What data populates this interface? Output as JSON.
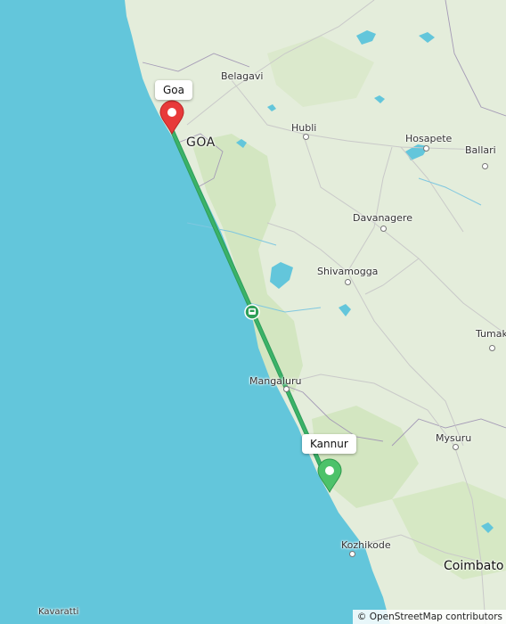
{
  "map": {
    "route": {
      "from": "Goa",
      "to": "Kannur",
      "route_color": "#3bb368",
      "start_marker_color": "#e83a3a",
      "end_marker_color": "#4cc26a"
    },
    "callouts": {
      "start": "Goa",
      "end": "Kannur"
    },
    "place_labels": {
      "belagavi": "Belagavi",
      "goa_state": "GOA",
      "hubli": "Hubli",
      "hosapete": "Hosapete",
      "ballari": "Ballari",
      "davanagere": "Davanagere",
      "shivamogga": "Shivamogga",
      "tumakuru": "Tumak",
      "mangaluru": "Mangaluru",
      "mysuru": "Mysuru",
      "kozhikode": "Kozhikode",
      "coimbatore": "Coimbato",
      "kavaratti": "Kavaratti"
    },
    "route_icon": "car-icon",
    "attribution": "© OpenStreetMap contributors",
    "colors": {
      "sea": "#63c6db",
      "land": "#e4eddb",
      "forest": "#d3e6c1"
    }
  }
}
